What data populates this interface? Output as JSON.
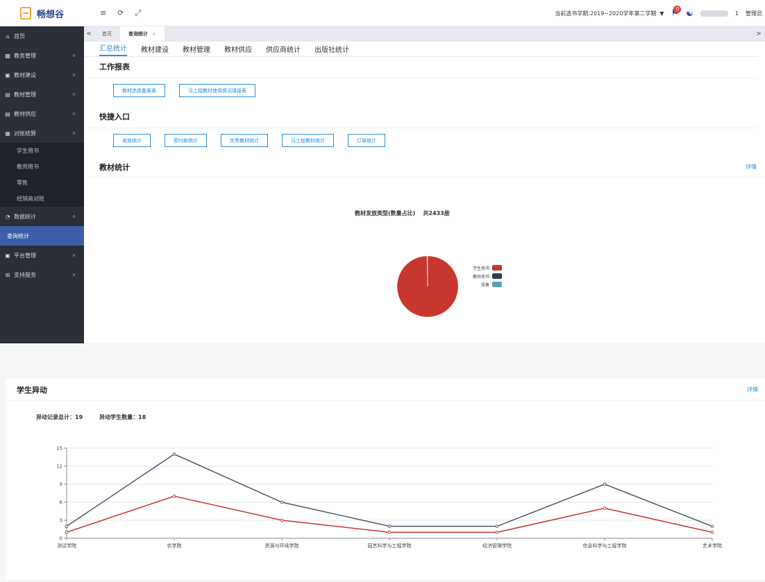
{
  "brand": {
    "name": "畅想谷"
  },
  "topbar": {
    "semester_label": "当前选书学期:2019~2020学年第二学期",
    "notification_count": "0",
    "user_suffix": "1",
    "user_role": "管理员"
  },
  "sidebar": {
    "items": [
      {
        "label": "首页"
      },
      {
        "label": "教务管理"
      },
      {
        "label": "教材建设"
      },
      {
        "label": "教材管理"
      },
      {
        "label": "教材供应"
      },
      {
        "label": "对账结算"
      },
      {
        "label": "学生用书"
      },
      {
        "label": "教师用书"
      },
      {
        "label": "零售"
      },
      {
        "label": "经销商对账"
      },
      {
        "label": "数据统计"
      },
      {
        "label": "查询统计"
      },
      {
        "label": "平台管理"
      },
      {
        "label": "支持服务"
      }
    ]
  },
  "tabs": {
    "home": "首页",
    "current": "查询统计"
  },
  "subnav": [
    "汇总统计",
    "教材建设",
    "教材管理",
    "教材供应",
    "供应商统计",
    "出版社统计"
  ],
  "work_report": {
    "title": "工作报表",
    "buttons": [
      "教材选用备案表",
      "马工程教材使用情况填报表"
    ]
  },
  "quick_entry": {
    "title": "快捷入口",
    "buttons": [
      "发放统计",
      "预付款统计",
      "优秀教材统计",
      "马工程教材统计",
      "订单统计"
    ]
  },
  "textbook_stats": {
    "title": "教材统计",
    "detail": "详情",
    "chart_title": "教材发放类型(数量占比)",
    "total": "共2433册"
  },
  "student_change": {
    "title": "学生异动",
    "detail": "详情",
    "record_label": "异动记录总计：",
    "record_value": "19",
    "student_label": "异动学生数量：",
    "student_value": "18"
  },
  "colors": {
    "accent": "#2e8cd8",
    "sidebar": "#2b2f36",
    "active": "#3d5ea8",
    "red": "#c7362f",
    "dark": "#2f3e4d",
    "teal": "#5ba3b0"
  },
  "chart_data": [
    {
      "type": "pie",
      "title": "教材发放类型(数量占比)",
      "subtitle": "共2433册",
      "labels": [
        "学生用书",
        "教师用书",
        "零售"
      ],
      "values": [
        2424,
        2,
        7
      ],
      "colors": [
        "#c7362f",
        "#2f3e4d",
        "#5ba3b0"
      ],
      "legend": "right"
    },
    {
      "type": "line",
      "categories": [
        "测试学院",
        "农学院",
        "资源与环境学院",
        "园艺科学与工程学院",
        "经济管理学院",
        "信息科学与工程学院",
        "艺术学院"
      ],
      "series": [
        {
          "values": [
            2,
            14,
            6,
            2,
            2,
            9,
            2
          ],
          "color": "#4a5a6b"
        },
        {
          "values": [
            1,
            7,
            3,
            1,
            1,
            5,
            1
          ],
          "color": "#c7362f"
        }
      ],
      "ylim": [
        0,
        15
      ],
      "yticks": [
        "0",
        "3",
        "6",
        "9",
        "12",
        "15"
      ],
      "grid": true
    }
  ]
}
